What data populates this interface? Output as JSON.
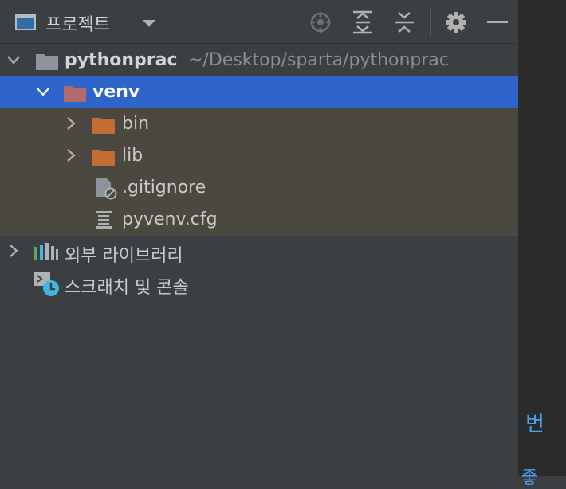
{
  "toolbar": {
    "title": "프로젝트",
    "view_icon": "project-view-icon",
    "dropdown_icon": "chevron-down-icon",
    "locate_icon": "crosshair-icon",
    "expand_icon": "expand-all-icon",
    "collapse_icon": "collapse-all-icon",
    "settings_icon": "gear-icon",
    "hide_icon": "minimize-icon"
  },
  "tree": {
    "root": {
      "name": "pythonprac",
      "path": "~/Desktop/sparta/pythonprac"
    },
    "venv": {
      "name": "venv"
    },
    "bin": {
      "name": "bin"
    },
    "lib": {
      "name": "lib"
    },
    "gitignore": {
      "name": ".gitignore"
    },
    "pyvenv": {
      "name": "pyvenv.cfg"
    },
    "ext_libs": {
      "name": "외부 라이브러리"
    },
    "scratches": {
      "name": "스크래치 및 콘솔"
    }
  },
  "right_edge": {
    "char1": "번",
    "char2": "좋"
  },
  "colors": {
    "selection": "#2f65ca",
    "venv_shade": "#4b483f",
    "excluded_folder": "#b36a6a",
    "folder_orange": "#c46c34",
    "folder_grey": "#8c949c"
  }
}
